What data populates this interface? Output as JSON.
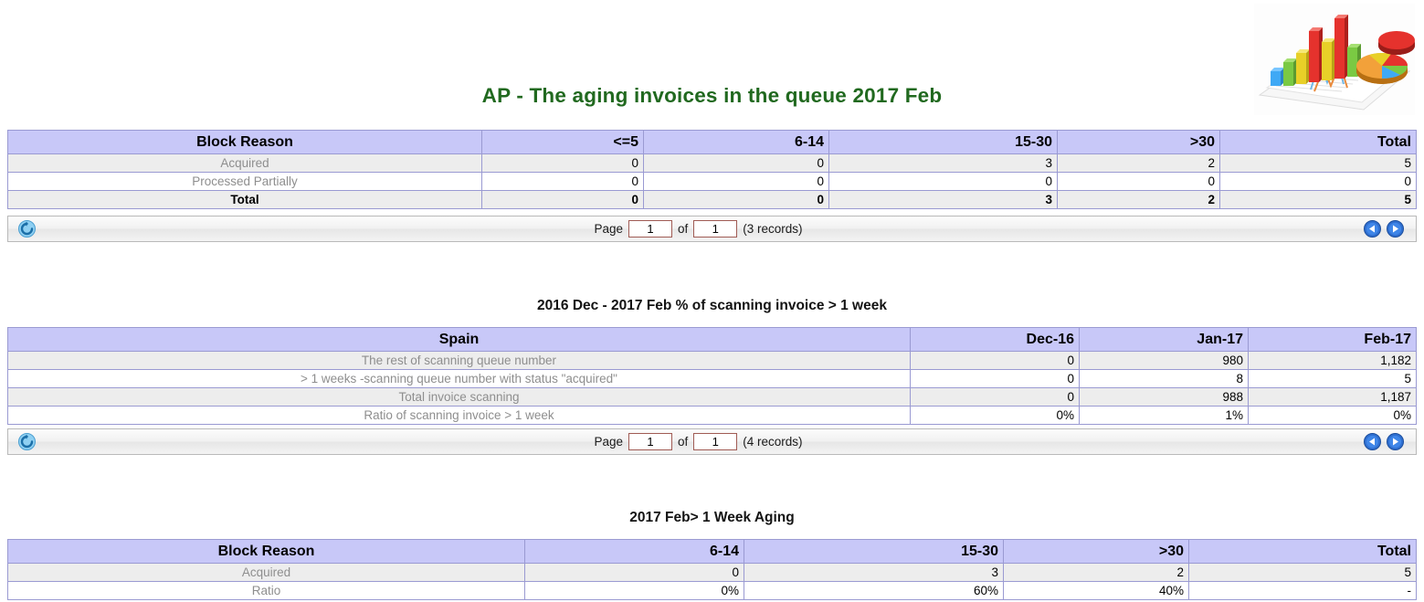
{
  "report": {
    "title": "AP - The aging invoices in the queue 2017 Feb",
    "title_color": "#21691f",
    "header_bg": "#c8c8f8"
  },
  "illustration": {
    "icon": "bar-pie-chart-illustration"
  },
  "section1": {
    "table": {
      "columns": [
        "Block Reason",
        "<=5",
        "6-14",
        "15-30",
        ">30",
        "Total"
      ],
      "rows": [
        {
          "label": "Acquired",
          "values": [
            "0",
            "0",
            "3",
            "2",
            "5"
          ],
          "is_total": false
        },
        {
          "label": "Processed Partially",
          "values": [
            "0",
            "0",
            "0",
            "0",
            "0"
          ],
          "is_total": false
        },
        {
          "label": "Total",
          "values": [
            "0",
            "0",
            "3",
            "2",
            "5"
          ],
          "is_total": true
        }
      ]
    },
    "pager": {
      "page_label": "Page",
      "of_label": "of",
      "page_value": "1",
      "total_pages": "1",
      "records": "(3 records)",
      "refresh_icon": "refresh-icon",
      "prev_icon": "previous-arrow-icon",
      "next_icon": "next-arrow-icon"
    }
  },
  "section2": {
    "title": "2016 Dec - 2017 Feb % of scanning invoice > 1 week",
    "table": {
      "columns": [
        "Spain",
        "Dec-16",
        "Jan-17",
        "Feb-17"
      ],
      "rows": [
        {
          "label": "The rest of scanning queue number",
          "values": [
            "0",
            "980",
            "1,182"
          ]
        },
        {
          "label": "> 1 weeks -scanning queue number with status \"acquired\"",
          "values": [
            "0",
            "8",
            "5"
          ]
        },
        {
          "label": "Total invoice scanning",
          "values": [
            "0",
            "988",
            "1,187"
          ]
        },
        {
          "label": "Ratio of scanning invoice > 1 week",
          "values": [
            "0%",
            "1%",
            "0%"
          ]
        }
      ]
    },
    "pager": {
      "page_label": "Page",
      "of_label": "of",
      "page_value": "1",
      "total_pages": "1",
      "records": "(4 records)",
      "refresh_icon": "refresh-icon",
      "prev_icon": "previous-arrow-icon",
      "next_icon": "next-arrow-icon"
    }
  },
  "section3": {
    "title": "2017 Feb> 1 Week Aging",
    "table": {
      "columns": [
        "Block Reason",
        "6-14",
        "15-30",
        ">30",
        "Total"
      ],
      "rows": [
        {
          "label": "Acquired",
          "values": [
            "0",
            "3",
            "2",
            "5"
          ]
        },
        {
          "label": "Ratio",
          "values": [
            "0%",
            "60%",
            "40%",
            "-"
          ]
        }
      ]
    }
  }
}
